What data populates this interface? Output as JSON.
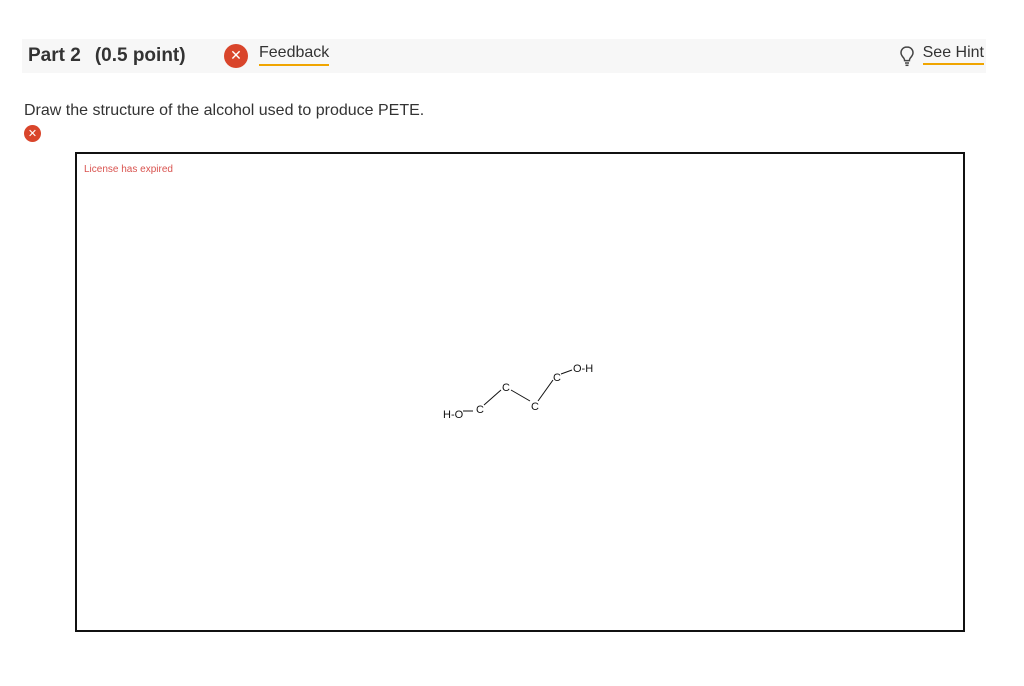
{
  "header": {
    "part_label": "Part 2",
    "points_label": "(0.5 point)",
    "feedback_label": "Feedback",
    "hint_label": "See Hint"
  },
  "question": {
    "prompt": "Draw the structure of the alcohol used to produce PETE."
  },
  "editor": {
    "license_message": "License has expired",
    "atoms": [
      "H-O",
      "C",
      "C",
      "C",
      "C",
      "O-H"
    ]
  },
  "colors": {
    "error_red": "#d9452b",
    "link_underline": "#f0a500",
    "license_text": "#d9534f"
  },
  "icons": {
    "status": "close-icon",
    "hint": "lightbulb-icon"
  }
}
